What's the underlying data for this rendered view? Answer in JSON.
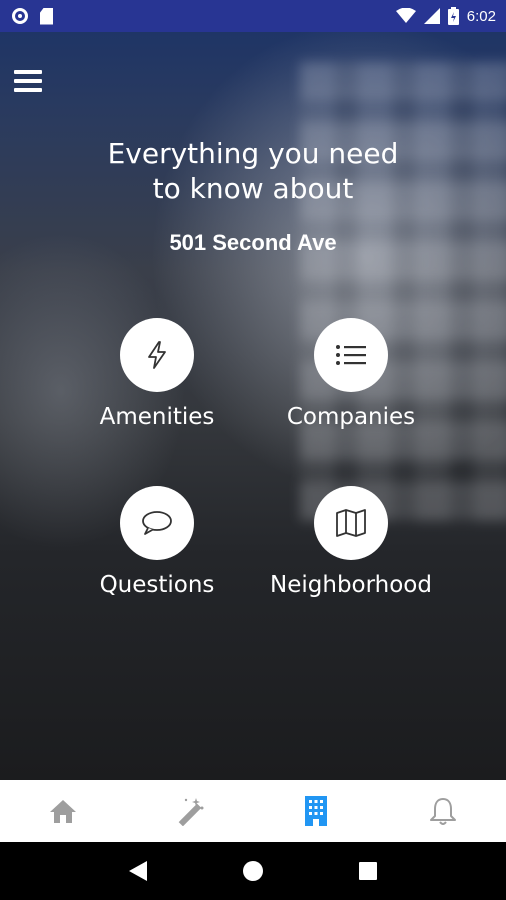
{
  "status_bar": {
    "time": "6:02",
    "icons": [
      "sync-circle-icon",
      "sd-card-icon",
      "wifi-icon",
      "signal-icon",
      "battery-icon"
    ]
  },
  "hero": {
    "headline_line1": "Everything you need",
    "headline_line2": "to know about",
    "building_name": "501 Second Ave"
  },
  "tiles": [
    {
      "label": "Amenities",
      "icon": "lightning-icon"
    },
    {
      "label": "Companies",
      "icon": "list-icon"
    },
    {
      "label": "Questions",
      "icon": "chat-bubble-icon"
    },
    {
      "label": "Neighborhood",
      "icon": "map-icon"
    }
  ],
  "bottom_nav": {
    "items": [
      {
        "name": "home",
        "icon": "home-icon"
      },
      {
        "name": "magic",
        "icon": "magic-wand-icon"
      },
      {
        "name": "building",
        "icon": "building-icon",
        "active": true
      },
      {
        "name": "notifications",
        "icon": "bell-icon"
      }
    ],
    "active_color": "#2196F3",
    "inactive_color": "#9E9E9E"
  },
  "colors": {
    "status_bar": "#283593",
    "icon_dark": "#333333"
  }
}
